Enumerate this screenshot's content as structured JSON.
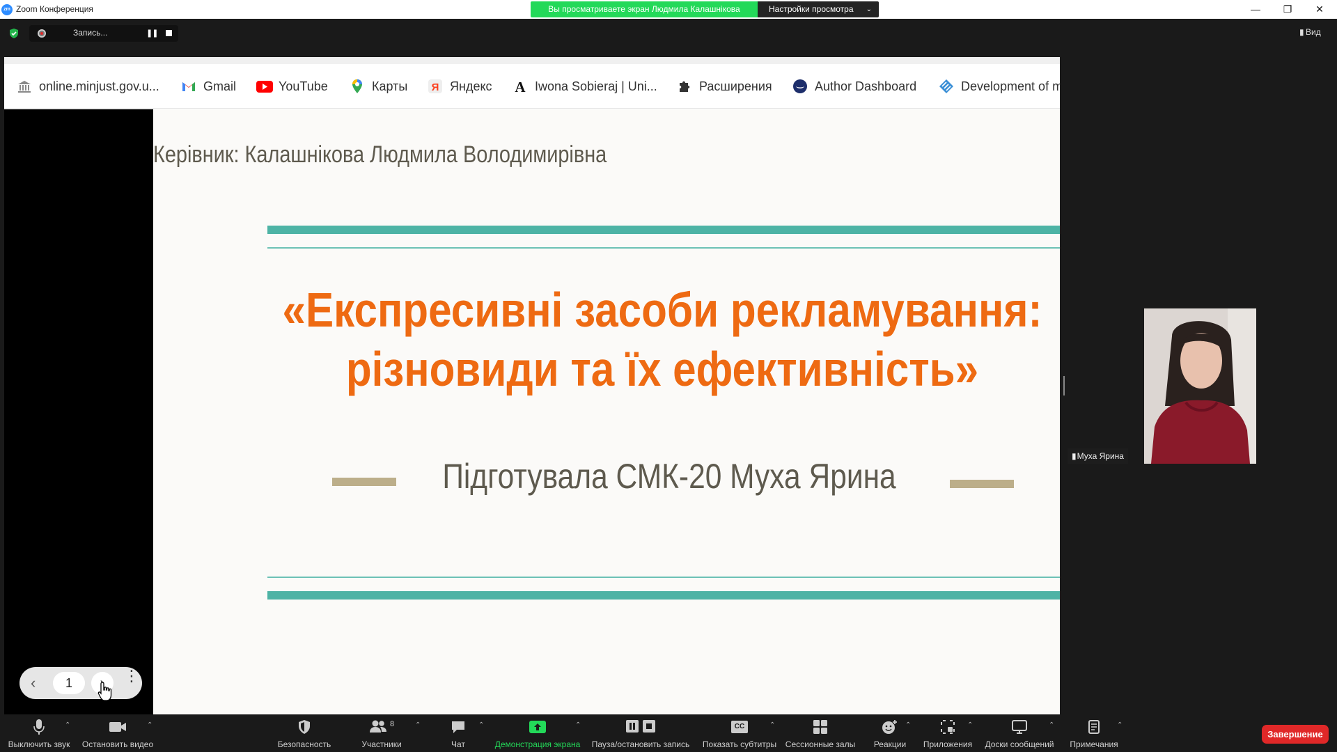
{
  "window": {
    "title": "Zoom Конференция",
    "logo_text": "zm",
    "viewing_banner": "Вы просматриваете экран Людмила Калашнікова",
    "view_settings": "Настройки просмотра"
  },
  "topbar": {
    "recording_label": "Запись...",
    "view_label": "Вид"
  },
  "bookmarks": [
    {
      "label": "online.minjust.gov.u...",
      "icon": "bank-icon"
    },
    {
      "label": "Gmail",
      "icon": "gmail-icon"
    },
    {
      "label": "YouTube",
      "icon": "youtube-icon"
    },
    {
      "label": "Карты",
      "icon": "maps-pin-icon"
    },
    {
      "label": "Яндекс",
      "icon": "yandex-icon"
    },
    {
      "label": "Iwona Sobieraj | Uni...",
      "icon": "letter-a-icon"
    },
    {
      "label": "Расширения",
      "icon": "puzzle-icon"
    },
    {
      "label": "Author Dashboard",
      "icon": "author-dashboard-icon"
    },
    {
      "label": "Development of m",
      "icon": "development-icon"
    }
  ],
  "slide": {
    "supervisor": "Керівник: Калашнікова Людмила Володимирівна",
    "title_line1": "«Експресивні засоби рекламування:",
    "title_line2": "різновиди та їх ефективність»",
    "prepared_by": "Підготувала СМК-20 Муха Ярина",
    "accent_color": "#ee6a12",
    "teal_color": "#4db3a5"
  },
  "slide_nav": {
    "page": "1"
  },
  "participant": {
    "name": "Муха Ярина"
  },
  "toolbar": {
    "mute": "Выключить звук",
    "stop_video": "Остановить видео",
    "security": "Безопасность",
    "participants": "Участники",
    "participants_count": "8",
    "chat": "Чат",
    "share_screen": "Демонстрация экрана",
    "pause_record": "Пауза/остановить запись",
    "captions": "Показать субтитры",
    "captions_icon_text": "CC",
    "breakout": "Сессионные залы",
    "reactions": "Реакции",
    "apps": "Приложения",
    "whiteboards": "Доски сообщений",
    "notes": "Примечания",
    "end": "Завершение"
  }
}
